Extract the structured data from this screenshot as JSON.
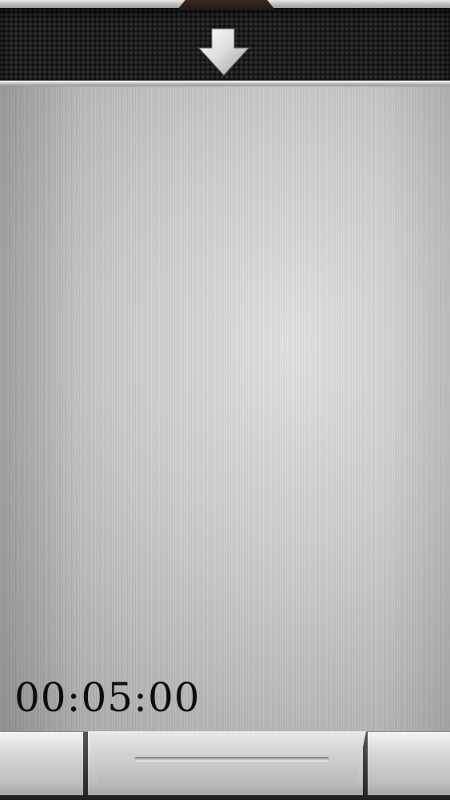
{
  "timer": {
    "value": "00:05:00"
  },
  "header": {
    "icon": "down-arrow-icon"
  },
  "footer": {
    "icon": "drawer-handle"
  },
  "colors": {
    "header_bg": "#1c1c1e",
    "metal": "#c9c9cb",
    "timer_text": "#0e0e0e"
  }
}
